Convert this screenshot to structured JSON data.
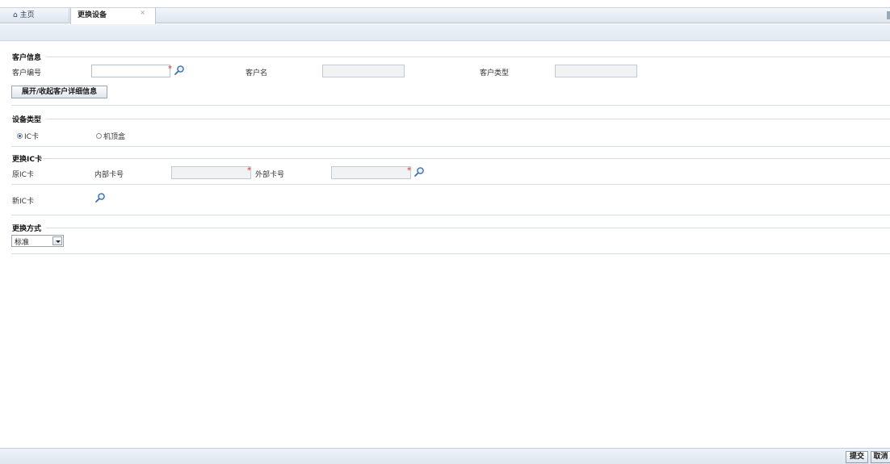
{
  "tabs": {
    "home_label": "主页",
    "active_label": "更换设备",
    "close_glyph": "×"
  },
  "customer_section": {
    "title": "客户信息",
    "customer_no_label": "客户编号",
    "customer_no_value": "",
    "customer_name_label": "客户名",
    "customer_name_value": "",
    "customer_type_label": "客户类型",
    "customer_type_value": "",
    "toggle_details_button": "展开/收起客户详细信息",
    "required_mark": "*"
  },
  "device_type_section": {
    "title": "设备类型",
    "options": [
      {
        "label": "IC卡",
        "selected": true
      },
      {
        "label": "机顶盒",
        "selected": false
      }
    ]
  },
  "ic_card_section": {
    "title": "更换IC卡",
    "original_card_label": "原IC卡",
    "internal_no_label": "内部卡号",
    "internal_no_value": "",
    "external_no_label": "外部卡号",
    "external_no_value": "",
    "new_card_label": "新IC卡",
    "required_mark": "*"
  },
  "replace_method_section": {
    "title": "更换方式",
    "selected_option": "标准"
  },
  "footer": {
    "submit_label": "提交",
    "cancel_label": "取消"
  },
  "icons": {
    "home": "home-icon",
    "search": "search-icon",
    "dropdown": "chevron-down-icon"
  },
  "colors": {
    "required": "#e0282e",
    "tab_bar": "#dde5ee",
    "search_icon": "#3b6fb6"
  }
}
